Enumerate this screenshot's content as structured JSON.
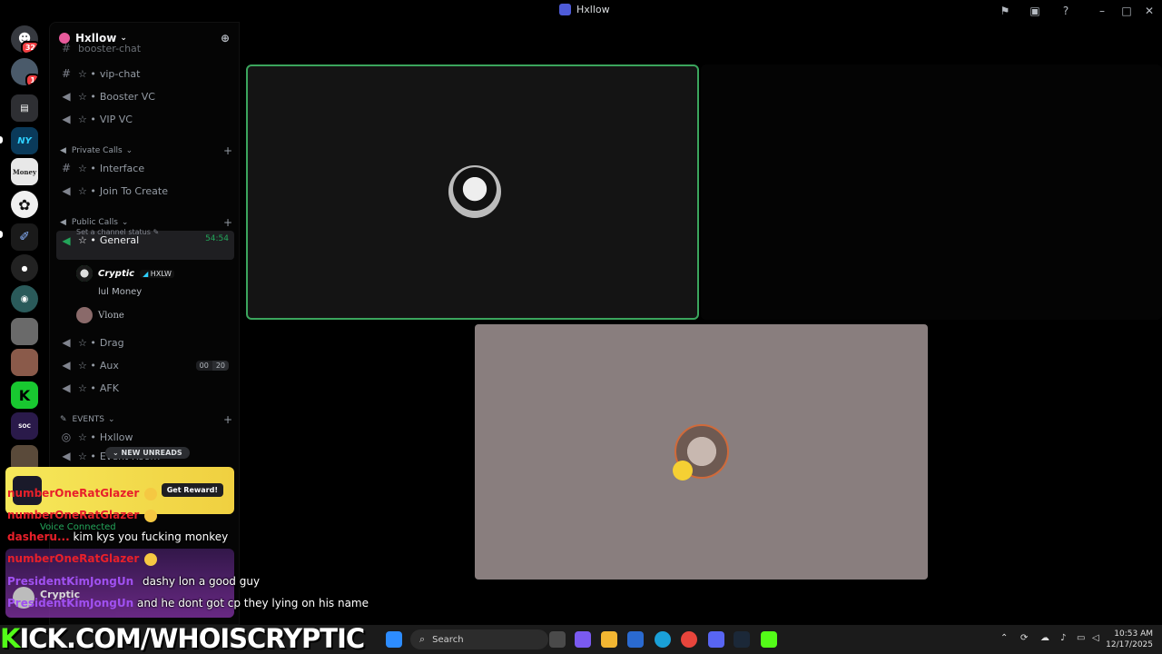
{
  "window": {
    "title": "Hxllow"
  },
  "rail": {
    "servers": [
      {
        "name": "direct-messages",
        "badge": "32",
        "color": "#36393f"
      },
      {
        "name": "server-2",
        "badge": "1",
        "color": "#4a5a6a"
      },
      {
        "name": "server-3",
        "badge": "",
        "color": "#2e2f33"
      },
      {
        "name": "server-ny",
        "label": "NY",
        "badge": "",
        "color": "#0a3a5a"
      },
      {
        "name": "server-money",
        "label": "Money",
        "badge": "",
        "color": "#e8e8e8"
      },
      {
        "name": "server-6",
        "badge": "",
        "color": "#f0f0f0"
      },
      {
        "name": "server-7",
        "badge": "",
        "color": "#1a1a1a"
      },
      {
        "name": "server-8",
        "badge": "",
        "color": "#222"
      },
      {
        "name": "server-9",
        "badge": "",
        "color": "#2a5a5a"
      },
      {
        "name": "server-10",
        "badge": "",
        "color": "#6a6a6a"
      },
      {
        "name": "server-11",
        "badge": "",
        "color": "#8a5a4a"
      },
      {
        "name": "server-kick",
        "label": "K",
        "badge": "",
        "color": "#18c830"
      },
      {
        "name": "server-13",
        "badge": "",
        "color": "#2a1a4a"
      },
      {
        "name": "server-14",
        "badge": "",
        "color": "#5a4a3a"
      }
    ]
  },
  "guild": {
    "name": "Hxllow"
  },
  "channels": {
    "top_partial": "booster-chat",
    "vip_chat": "vip-chat",
    "booster_vc": "Booster VC",
    "vip_vc": "VIP VC",
    "private_calls": "Private Calls",
    "interface": "Interface",
    "join_to_create": "Join To Create",
    "public_calls": "Public Calls",
    "general": "General",
    "general_timer": "54:54",
    "general_status": "Set a channel status",
    "drag": "Drag",
    "aux": "Aux",
    "aux_count_a": "00",
    "aux_count_b": "20",
    "afk": "AFK",
    "events": "EVENTS",
    "hxllow": "Hxllow",
    "event_room": "Event Room",
    "new_unreads": "NEW UNREADS"
  },
  "voice_users": [
    {
      "name": "Cryptic",
      "tag": "HXLW"
    },
    {
      "name": "lul Money"
    },
    {
      "name": "Vlone"
    }
  ],
  "reward": {
    "button": "Get Reward!"
  },
  "voice": {
    "status": "Voice Connected"
  },
  "user": {
    "name": "Cryptic"
  },
  "chat": [
    {
      "nick": "numberOneRatGlazer",
      "msg": "",
      "nick_color": "red"
    },
    {
      "nick": "numberOneRatGlazer",
      "msg": "",
      "nick_color": "red"
    },
    {
      "nick": "dasheru...",
      "msg": "kim kys you fucking monkey",
      "nick_color": "red"
    },
    {
      "nick": "numberOneRatGlazer",
      "msg": "",
      "nick_color": "red"
    },
    {
      "nick": "PresidentKimJongUn",
      "msg": "dashy lon a good guy",
      "nick_color": "purple"
    },
    {
      "nick": "PresidentKimJongUn",
      "msg": "and he dont got cp they lying on his name",
      "nick_color": "purple"
    }
  ],
  "banner": {
    "text_k": "K",
    "text_rest": "ICK.COM/WHOISCRYPTIC"
  },
  "taskbar": {
    "search_placeholder": "Search",
    "time": "10:53 AM",
    "date": "12/17/2025"
  }
}
